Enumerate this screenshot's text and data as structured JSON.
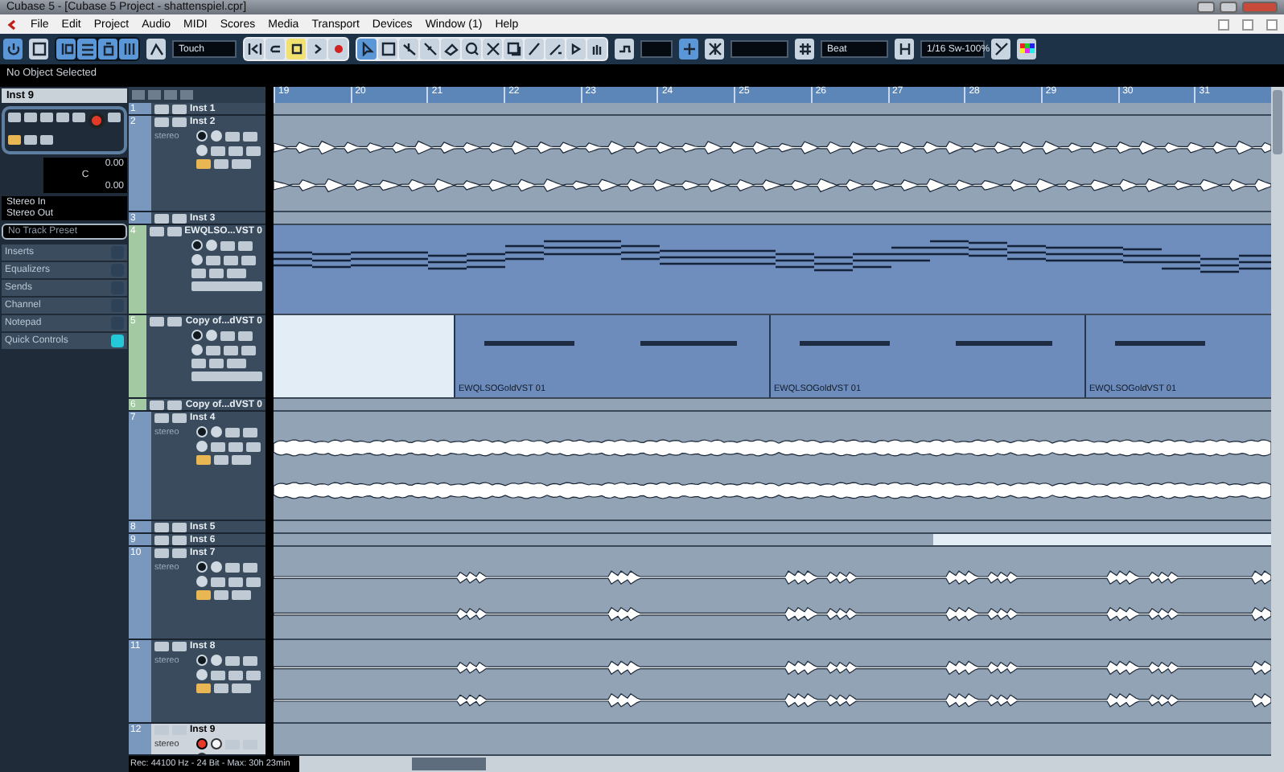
{
  "window": {
    "title": "Cubase 5 - [Cubase 5 Project - shattenspiel.cpr]"
  },
  "menu": [
    "File",
    "Edit",
    "Project",
    "Audio",
    "MIDI",
    "Scores",
    "Media",
    "Transport",
    "Devices",
    "Window (1)",
    "Help"
  ],
  "toolbar": {
    "automation_mode": "Touch",
    "grid_type": "Beat",
    "quantize": "1/16 Sw-100%"
  },
  "info_line": "No Object Selected",
  "inspector": {
    "track_name": "Inst 9",
    "record_enabled": true,
    "volume": "0.00",
    "pan": "C",
    "delay": "0.00",
    "input": "Stereo In",
    "output": "Stereo Out",
    "preset_placeholder": "No Track Preset",
    "sections": [
      {
        "label": "Inserts",
        "selected": false
      },
      {
        "label": "Equalizers",
        "selected": false
      },
      {
        "label": "Sends",
        "selected": false
      },
      {
        "label": "Channel",
        "selected": false
      },
      {
        "label": "Notepad",
        "selected": false
      },
      {
        "label": "Quick Controls",
        "selected": true
      }
    ]
  },
  "ruler": {
    "bars": [
      "19",
      "20",
      "21",
      "22",
      "23",
      "24",
      "25",
      "26",
      "27",
      "28",
      "29",
      "30",
      "31"
    ]
  },
  "tracks": [
    {
      "number": "1",
      "name": "Inst 1",
      "kind": "audio",
      "expanded": false,
      "selected": false
    },
    {
      "number": "2",
      "name": "Inst 2",
      "kind": "audio",
      "expanded": true,
      "selected": false,
      "channel_format": "stereo",
      "record_enabled": false,
      "clip": {
        "kind": "waveform"
      }
    },
    {
      "number": "3",
      "name": "Inst 3",
      "kind": "audio",
      "expanded": false,
      "selected": false
    },
    {
      "number": "4",
      "name": "EWQLSO...VST 0",
      "kind": "midi",
      "expanded": true,
      "selected": false,
      "record_enabled": false,
      "clip": {
        "kind": "notes"
      }
    },
    {
      "number": "5",
      "name": "Copy of...dVST 0",
      "kind": "midi",
      "expanded": true,
      "selected": false,
      "record_enabled": false,
      "clip": {
        "kind": "parts",
        "parts": [
          "EWQLSOGoldVST 01",
          "EWQLSOGoldVST 01",
          "EWQLSOGoldVST 01"
        ]
      }
    },
    {
      "number": "6",
      "name": "Copy of...dVST 0",
      "kind": "midi",
      "expanded": false,
      "selected": false
    },
    {
      "number": "7",
      "name": "Inst 4",
      "kind": "audio",
      "expanded": true,
      "selected": false,
      "channel_format": "stereo",
      "record_enabled": false,
      "clip": {
        "kind": "dense-waveform"
      }
    },
    {
      "number": "8",
      "name": "Inst 5",
      "kind": "audio",
      "expanded": false,
      "selected": false
    },
    {
      "number": "9",
      "name": "Inst 6",
      "kind": "audio",
      "expanded": false,
      "selected": false,
      "clip": {
        "kind": "range"
      }
    },
    {
      "number": "10",
      "name": "Inst 7",
      "kind": "audio",
      "expanded": true,
      "selected": false,
      "channel_format": "stereo",
      "record_enabled": false,
      "clip": {
        "kind": "sparse-waveform"
      }
    },
    {
      "number": "11",
      "name": "Inst 8",
      "kind": "audio",
      "expanded": true,
      "selected": false,
      "channel_format": "stereo",
      "record_enabled": false,
      "clip": {
        "kind": "sparse-waveform"
      }
    },
    {
      "number": "12",
      "name": "Inst 9",
      "kind": "audio",
      "expanded": true,
      "selected": true,
      "channel_format": "stereo",
      "record_enabled": true
    }
  ],
  "status_bar": "Rec: 44100 Hz - 24 Bit - Max: 30h 23min"
}
